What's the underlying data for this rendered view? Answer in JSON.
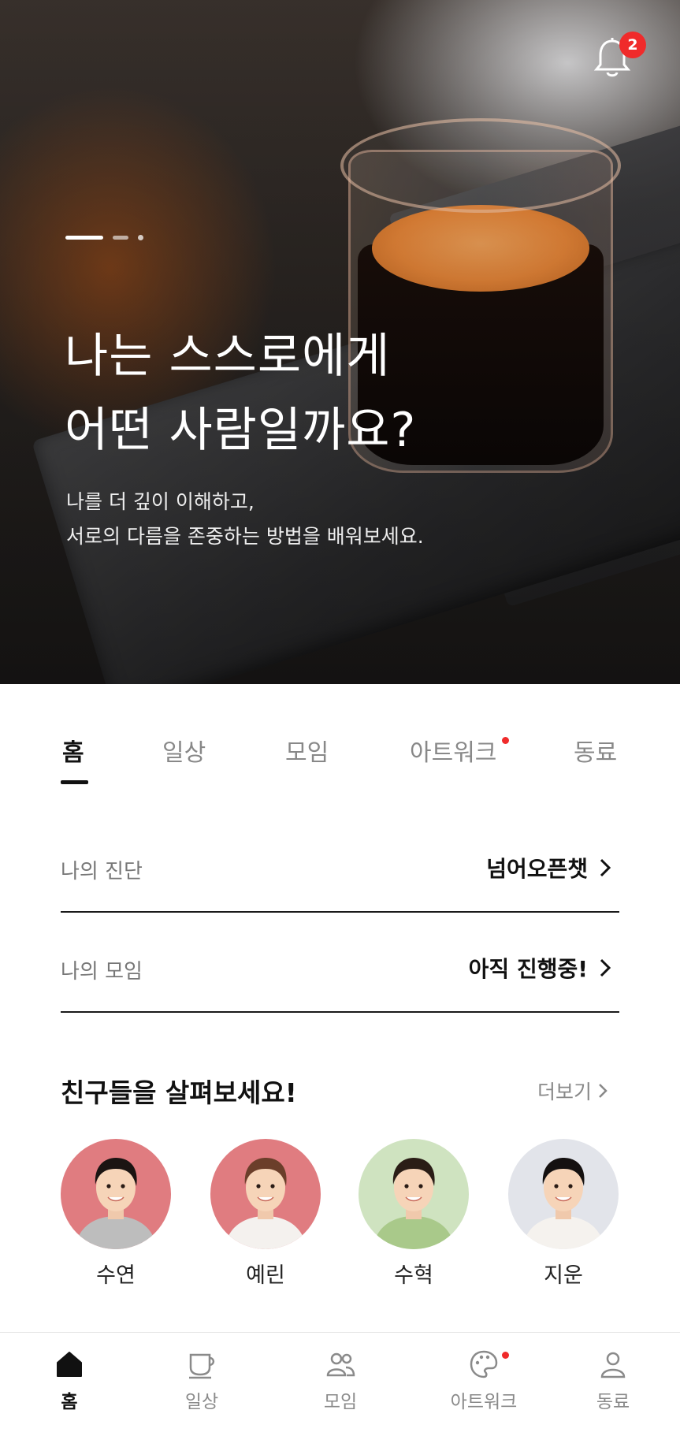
{
  "hero": {
    "notification_count": "2",
    "carousel": {
      "total": 3,
      "active_index": 0
    },
    "title_line1": "나는 스스로에게",
    "title_line2": "어떤 사람일까요?",
    "subtitle_line1": "나를 더 깊이 이해하고,",
    "subtitle_line2": "서로의 다름을 존중하는 방법을 배워보세요."
  },
  "tabs": [
    {
      "label": "홈",
      "active": true,
      "dot": false
    },
    {
      "label": "일상",
      "active": false,
      "dot": false
    },
    {
      "label": "모임",
      "active": false,
      "dot": false
    },
    {
      "label": "아트워크",
      "active": false,
      "dot": true
    },
    {
      "label": "동료",
      "active": false,
      "dot": false
    }
  ],
  "rows": [
    {
      "label": "나의 진단",
      "value": "넘어오픈챗"
    },
    {
      "label": "나의 모임",
      "value": "아직 진행중!"
    }
  ],
  "friends": {
    "title": "친구들을 살펴보세요!",
    "more_label": "더보기",
    "people": [
      {
        "name": "수연",
        "bg": "#e07c80",
        "shirt": "#bdbdbd",
        "hair": "#1b1412"
      },
      {
        "name": "예린",
        "bg": "#e07c80",
        "shirt": "#f4f1ee",
        "hair": "#6b3e2a"
      },
      {
        "name": "수혁",
        "bg": "#cfe3c0",
        "shirt": "#a9c98a",
        "hair": "#2a1d16"
      },
      {
        "name": "지운",
        "bg": "#e2e4ea",
        "shirt": "#f5f2ee",
        "hair": "#141010"
      }
    ]
  },
  "bottom_nav": [
    {
      "label": "홈",
      "icon": "home-icon",
      "active": true,
      "dot": false
    },
    {
      "label": "일상",
      "icon": "coffee-cup-icon",
      "active": false,
      "dot": false
    },
    {
      "label": "모임",
      "icon": "group-icon",
      "active": false,
      "dot": false
    },
    {
      "label": "아트워크",
      "icon": "palette-icon",
      "active": false,
      "dot": true
    },
    {
      "label": "동료",
      "icon": "person-icon",
      "active": false,
      "dot": false
    }
  ],
  "colors": {
    "accent_red": "#f02b2b",
    "text_dark": "#111111",
    "text_muted": "#888888"
  }
}
